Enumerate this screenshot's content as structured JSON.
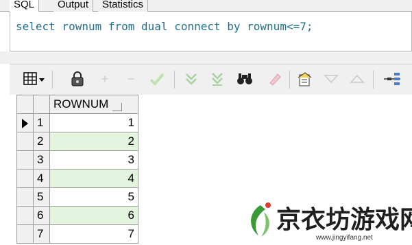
{
  "tabs": [
    {
      "label": "SQL",
      "active": true
    },
    {
      "label": "Output",
      "active": false
    },
    {
      "label": "Statistics",
      "active": false
    }
  ],
  "editor": {
    "sql": "select rownum from dual connect by rownum<=7;"
  },
  "toolbar": {
    "icons": [
      "grid-layout-icon",
      "lock-icon",
      "plus-icon",
      "minus-icon",
      "check-icon",
      "fetch-next-icon",
      "fetch-last-icon",
      "find-icon",
      "clear-icon",
      "export-icon",
      "sort-down-icon",
      "sort-up-icon",
      "tree-icon"
    ]
  },
  "grid": {
    "columns": [
      "ROWNUM"
    ],
    "rows": [
      {
        "num": "1",
        "value": "1"
      },
      {
        "num": "2",
        "value": "2"
      },
      {
        "num": "3",
        "value": "3"
      },
      {
        "num": "4",
        "value": "4"
      },
      {
        "num": "5",
        "value": "5"
      },
      {
        "num": "6",
        "value": "6"
      },
      {
        "num": "7",
        "value": "7"
      }
    ],
    "alt_row_color": "#e3f5de",
    "current_row": 1
  },
  "watermark": {
    "title": "京衣坊游戏网",
    "url": "www.jingyifang.net"
  }
}
